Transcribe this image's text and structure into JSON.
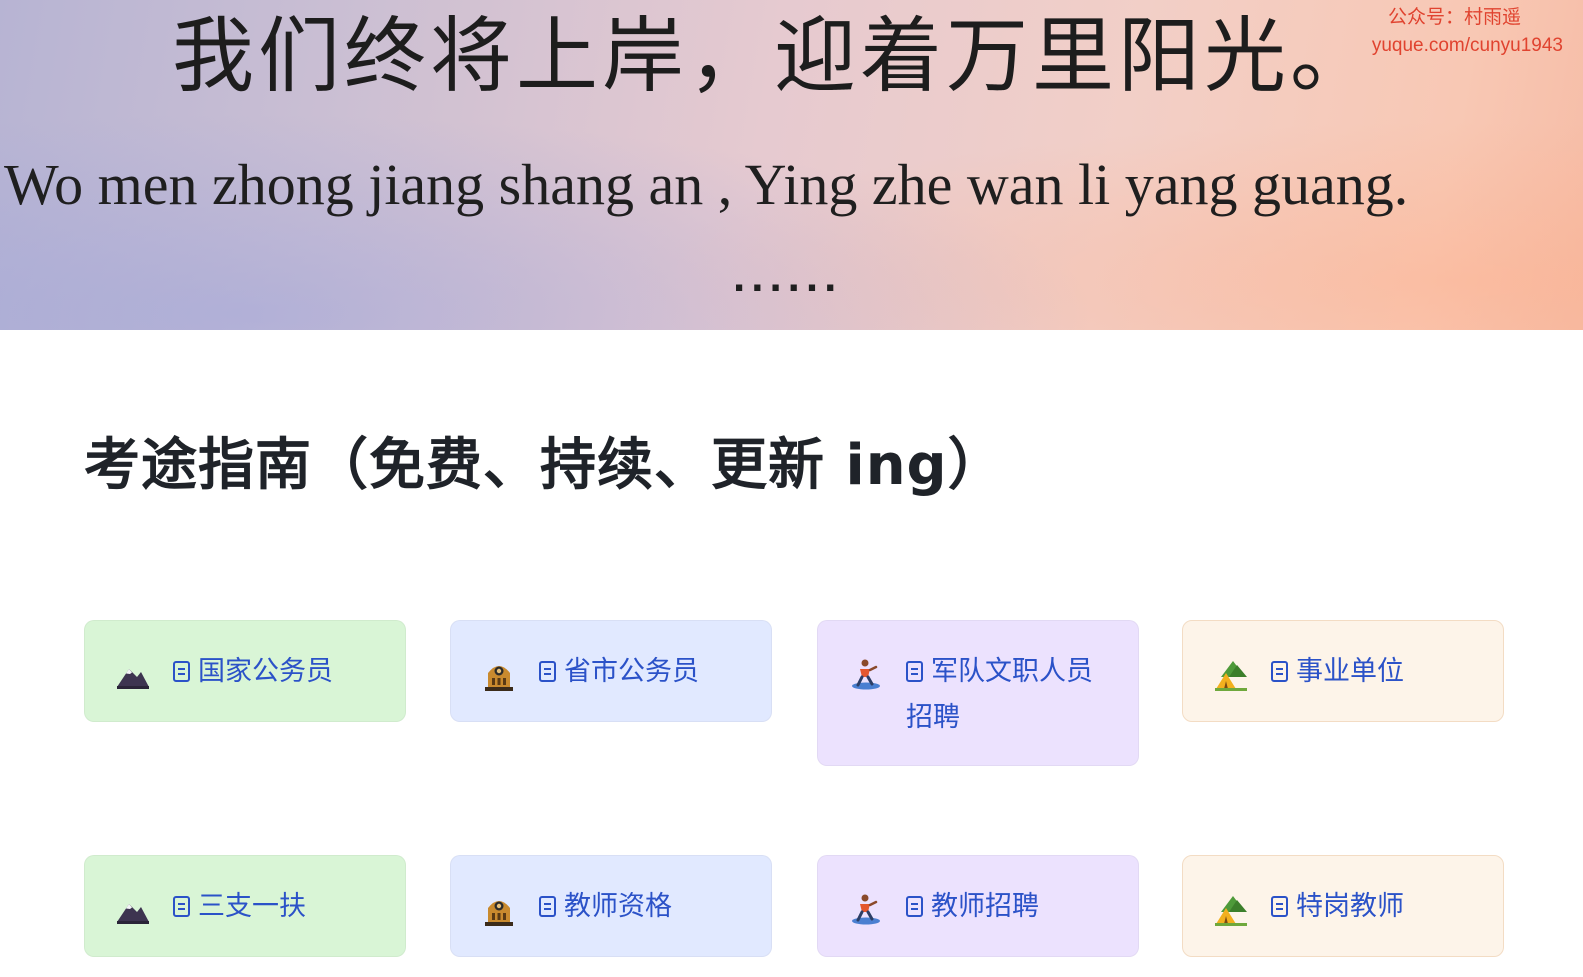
{
  "banner": {
    "chinese_text": "我们终将上岸，迎着万里阳光。",
    "pinyin_text": "Wo men zhong jiang shang an , Ying zhe wan li yang guang.",
    "dots": "......",
    "watermark_line1": "公众号：村雨遥",
    "watermark_line2": "yuque.com/cunyu1943"
  },
  "section": {
    "title": "考途指南（免费、持续、更新 ing）"
  },
  "cards": [
    {
      "label": "国家公务员",
      "icon": "mountain-icon",
      "color": "#d9f5d6"
    },
    {
      "label": "省市公务员",
      "icon": "building-icon",
      "color": "#e1e9ff"
    },
    {
      "label": "军队文职人员招聘",
      "icon": "surfer-icon",
      "color": "#ece2fe"
    },
    {
      "label": "事业单位",
      "icon": "camping-icon",
      "color": "#fdf4e9"
    },
    {
      "label": "三支一扶",
      "icon": "mountain-icon",
      "color": "#d9f5d6"
    },
    {
      "label": "教师资格",
      "icon": "building-icon",
      "color": "#e1e9ff"
    },
    {
      "label": "教师招聘",
      "icon": "surfer-icon",
      "color": "#ece2fe"
    },
    {
      "label": "特岗教师",
      "icon": "camping-icon",
      "color": "#fdf4e9"
    }
  ],
  "link_color": "#2b52c8"
}
